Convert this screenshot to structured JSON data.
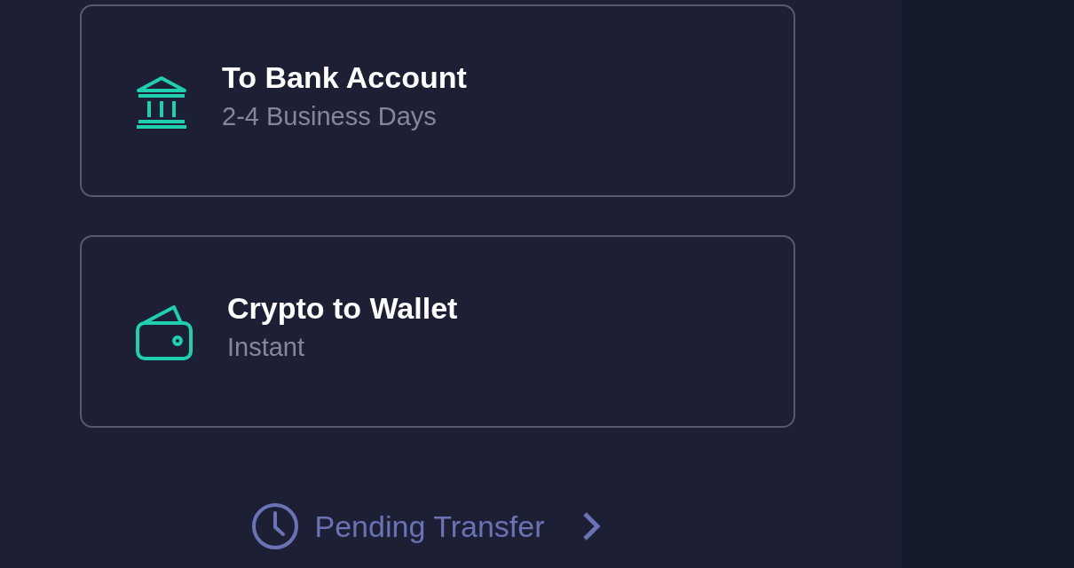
{
  "options": [
    {
      "kind": "bank",
      "title": "To Bank Account",
      "subtitle": "2-4 Business Days"
    },
    {
      "kind": "wallet",
      "title": "Crypto to Wallet",
      "subtitle": "Instant"
    }
  ],
  "pending_link": {
    "label": "Pending Transfer"
  }
}
